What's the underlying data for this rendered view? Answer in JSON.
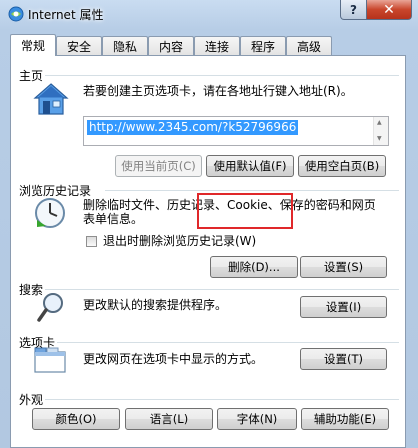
{
  "window": {
    "title": "Internet 属性",
    "help_label": "?",
    "close_label": "✕"
  },
  "tabs": [
    "常规",
    "安全",
    "隐私",
    "内容",
    "连接",
    "程序",
    "高级"
  ],
  "homepage": {
    "title": "主页",
    "desc": "若要创建主页选项卡，请在各地址行键入地址(R)。",
    "url": "http://www.2345.com/?k52796966",
    "use_current": "使用当前页(C)",
    "use_default": "使用默认值(F)",
    "use_blank": "使用空白页(B)"
  },
  "history": {
    "title": "浏览历史记录",
    "desc_line1": "删除临时文件、历史记录、Cookie、保存的密码和网页",
    "desc_line2": "表单信息。",
    "checkbox_label": "退出时删除浏览历史记录(W)",
    "delete_button": "删除(D)...",
    "settings_button": "设置(S)"
  },
  "search": {
    "title": "搜索",
    "desc": "更改默认的搜索提供程序。",
    "settings_button": "设置(I)"
  },
  "tabs_section": {
    "title": "选项卡",
    "desc": "更改网页在选项卡中显示的方式。",
    "settings_button": "设置(T)"
  },
  "appearance": {
    "title": "外观",
    "colors": "颜色(O)",
    "languages": "语言(L)",
    "fonts": "字体(N)",
    "accessibility": "辅助功能(E)"
  }
}
